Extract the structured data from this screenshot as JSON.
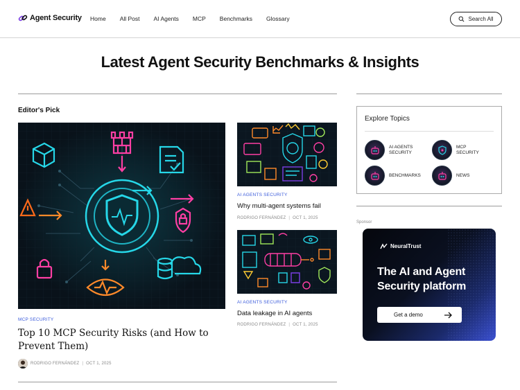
{
  "header": {
    "logo_text": "Agent Security",
    "nav": [
      "Home",
      "All Post",
      "AI Agents",
      "MCP",
      "Benchmarks",
      "Glossary"
    ],
    "search_label": "Search All"
  },
  "page_title": "Latest Agent Security Benchmarks & Insights",
  "editors_pick": {
    "label": "Editor's Pick",
    "featured": {
      "category": "MCP SECURITY",
      "title": "Top 10 MCP Security Risks (and How to Prevent Them)",
      "author": "RODRIGO FERNÁNDEZ",
      "date": "OCT 1, 2025"
    },
    "side_posts": [
      {
        "category": "AI AGENTS SECURITY",
        "title": "Why multi-agent systems fail",
        "author": "RODRIGO FERNÁNDEZ",
        "date": "OCT 1, 2025"
      },
      {
        "category": "AI AGENTS SECURITY",
        "title": "Data leakage in AI agents",
        "author": "RODRIGO FERNÁNDEZ",
        "date": "OCT 1, 2025"
      }
    ],
    "meta_separator": "|"
  },
  "explore": {
    "title": "Explore Topics",
    "topics": [
      {
        "label": "AI AGENTS SECURITY"
      },
      {
        "label": "MCP SECURITY"
      },
      {
        "label": "BENCHMARKS"
      },
      {
        "label": "NEWS"
      }
    ]
  },
  "sponsor": {
    "label": "Sponsor",
    "brand": "NeuralTrust",
    "headline": "The AI and Agent Security platform",
    "cta": "Get a demo"
  },
  "colors": {
    "accent_blue": "#3b5bdb",
    "neon_cyan": "#26d7e8",
    "neon_pink": "#ff3fa4",
    "neon_orange": "#ff8a2a"
  }
}
